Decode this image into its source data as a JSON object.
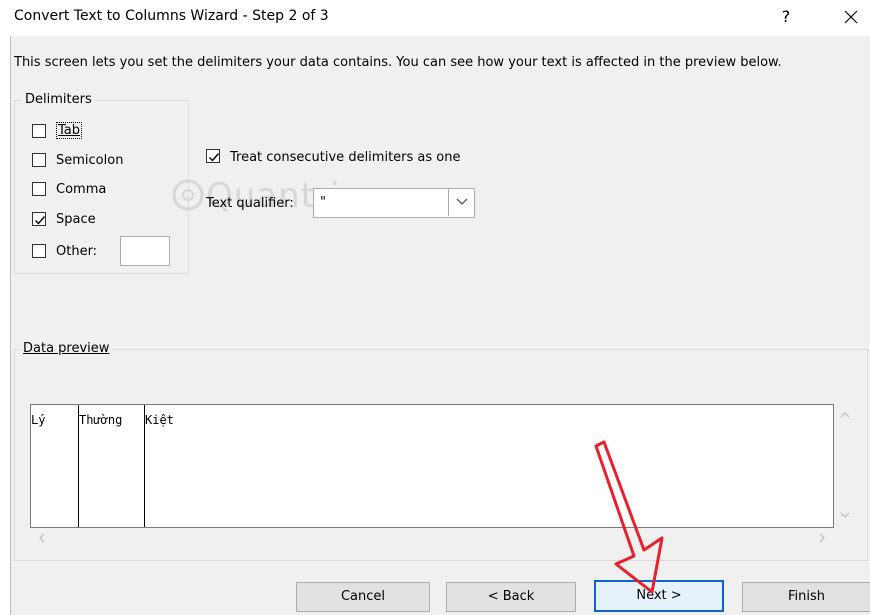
{
  "window": {
    "title": "Convert Text to Columns Wizard - Step 2 of 3",
    "help_label": "?",
    "close_label": "✕"
  },
  "description": "This screen lets you set the delimiters your data contains.  You can see how your text is affected in the preview below.",
  "delimiters": {
    "legend": "Delimiters",
    "options": [
      {
        "label": "Tab",
        "checked": false
      },
      {
        "label": "Semicolon",
        "checked": false
      },
      {
        "label": "Comma",
        "checked": false
      },
      {
        "label": "Space",
        "checked": true
      },
      {
        "label": "Other:",
        "checked": false
      }
    ],
    "other_value": ""
  },
  "consecutive": {
    "label": "Treat consecutive delimiters as one",
    "checked": true
  },
  "qualifier": {
    "label": "Text qualifier:",
    "value": "\""
  },
  "watermark": "Quantrimang",
  "preview": {
    "legend": "Data preview",
    "columns": [
      "Lý",
      "Thường",
      "Kiệt"
    ]
  },
  "buttons": {
    "cancel": "Cancel",
    "back": "< Back",
    "next": "Next >",
    "finish": "Finish"
  },
  "colors": {
    "dialog_bg": "#f0f0f0",
    "accent": "#0a64d6",
    "annotation_arrow": "#e8202a"
  }
}
